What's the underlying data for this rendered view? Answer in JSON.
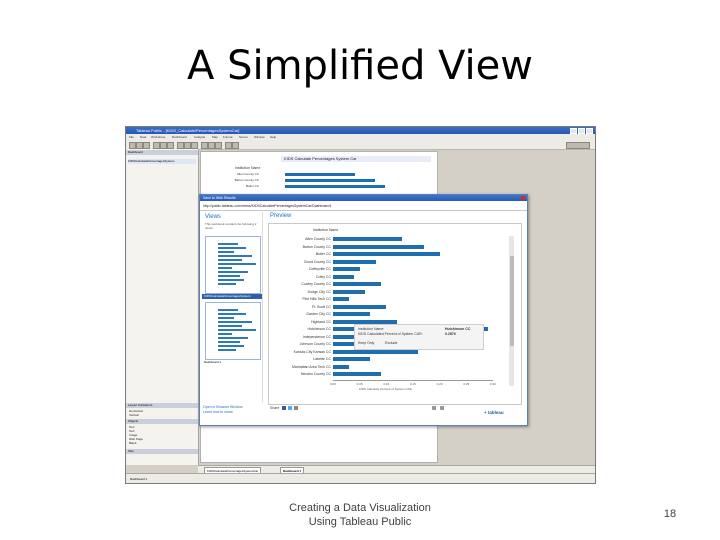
{
  "slide": {
    "title": "A Simplified View",
    "footer_line1": "Creating a Data Visualization",
    "footer_line2": "Using Tableau Public",
    "page_number": "18"
  },
  "window": {
    "title": "Tableau Public - [KIDS_Calculate/PercentagesSystemCar]",
    "menu": [
      "File",
      "Data",
      "Worksheet",
      "Dashboard",
      "Analysis",
      "Map",
      "Format",
      "Server",
      "Window",
      "Help"
    ]
  },
  "left_pane": {
    "dashboard_header": "Dashboard",
    "sheet_item": "KIDSCalculatePercentagesSystem",
    "layout_header": "Layout Containers",
    "layout_items": [
      "Horizontal",
      "Vertical"
    ],
    "objects_header": "Objects",
    "object_items": [
      "Text",
      "Text",
      "Image",
      "Web Page",
      "Blank"
    ],
    "size_header": "Size"
  },
  "dashboard": {
    "title": "KIDS Calculate Percentages System Car",
    "header": "Institution Name",
    "rows": [
      {
        "label": "Allen County CC",
        "value": 0.55
      },
      {
        "label": "Barton County CC",
        "value": 0.62
      },
      {
        "label": "Butler CC",
        "value": 0.7
      }
    ]
  },
  "dialog": {
    "title": "Save to Web Results",
    "url": "http://public.tableau.com/views/KIDSCalculatePercentagesSystemCar/Dashboard1",
    "views_title": "Views",
    "views_desc": "This workbook contains the following 2 views:",
    "thumb1_caption": "KIDSCalculatePercentagesSystem",
    "thumb2_caption": "Dashboard 1",
    "preview_title": "Preview",
    "preview_header": "Institution Name",
    "links": [
      "Open in Browser Window",
      "Learn how to share"
    ],
    "share_label": "Share",
    "tableau_label": "+ tableau",
    "axis_label": "KIDS Calculate Percent of System CAR",
    "axis_ticks": [
      "0.00",
      "0.05",
      "0.10",
      "0.15",
      "0.20",
      "0.25",
      "0.30"
    ],
    "tooltip": {
      "line1": "Institution Name:",
      "line1_value": "Hutchinson CC",
      "line2": "KIDS Calculated Percent of System CAR:",
      "line2_value": "0.2876",
      "keep": "Keep Only",
      "exclude": "Exclude"
    }
  },
  "chart_data": {
    "type": "bar",
    "categories": [
      "Allen County CC",
      "Barton County CC",
      "Butler CC",
      "Cloud County CC",
      "Coffeyville CC",
      "Colby CC",
      "Cowley County CC",
      "Dodge City CC",
      "Flint Hills Tech CC",
      "Ft. Scott CC",
      "Garden City CC",
      "Highland CC",
      "Hutchinson CC",
      "Independence CC",
      "Johnson County CC",
      "Kansas City Kansas CC",
      "Labette CC",
      "Manhattan Area Tech CC",
      "Neosho County CC"
    ],
    "values": [
      0.13,
      0.17,
      0.2,
      0.08,
      0.05,
      0.04,
      0.09,
      0.06,
      0.03,
      0.1,
      0.07,
      0.12,
      0.29,
      0.05,
      0.28,
      0.16,
      0.07,
      0.03,
      0.09
    ],
    "xlabel": "KIDS Calculate Percent of System CAR",
    "xlim": [
      0,
      0.3
    ],
    "ylabel": "Institution Name"
  },
  "tabs": [
    "KIDSCalculatePercentagesSystemCar",
    "Dashboard 1"
  ],
  "status": "Dashboard 1"
}
